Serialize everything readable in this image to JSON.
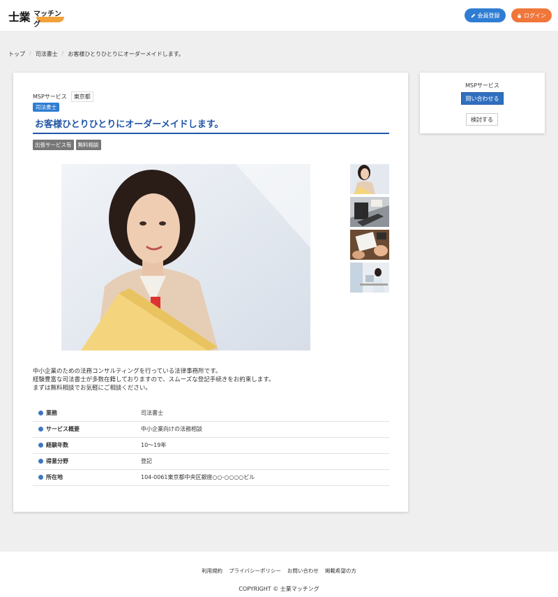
{
  "header": {
    "logo_main": "士業",
    "logo_sub": "マッチング",
    "register_label": "会員登録",
    "login_label": "ログイン"
  },
  "breadcrumb": [
    "トップ",
    "司法書士",
    "お客様ひとりひとりにオーダーメイドします。"
  ],
  "listing": {
    "provider": "MSPサービス",
    "prefecture": "東京都",
    "category": "司法書士",
    "title": "お客様ひとりひとりにオーダーメイドします。",
    "tags": [
      "出張サービス有",
      "無料相談"
    ],
    "description": [
      "中小企業のための法務コンサルティングを行っている法律事務所です。",
      "経験豊富な司法書士が多数在籍しておりますので、スムーズな登記手続きをお約束します。",
      "まずは無料相談でお気軽にご相談ください。"
    ],
    "details": [
      {
        "label": "業務",
        "value": "司法書士"
      },
      {
        "label": "サービス概要",
        "value": "中小企業向けの法務相談"
      },
      {
        "label": "経験年数",
        "value": "10～19年"
      },
      {
        "label": "得意分野",
        "value": "登記"
      },
      {
        "label": "所在地",
        "value": "104-0061東京都中央区銀座○○-○○○○ビル"
      }
    ]
  },
  "sidebar": {
    "provider": "MSPサービス",
    "inquiry_label": "問い合わせる",
    "consider_label": "検討する"
  },
  "footer": {
    "links": [
      "利用規約",
      "プライバシーポリシー",
      "お問い合わせ",
      "掲載希望の方"
    ],
    "copyright": "COPYRIGHT © 士業マッチング"
  },
  "colors": {
    "accent_blue": "#2f7dd3",
    "title_blue": "#2155a8",
    "login_orange": "#f0763a"
  }
}
